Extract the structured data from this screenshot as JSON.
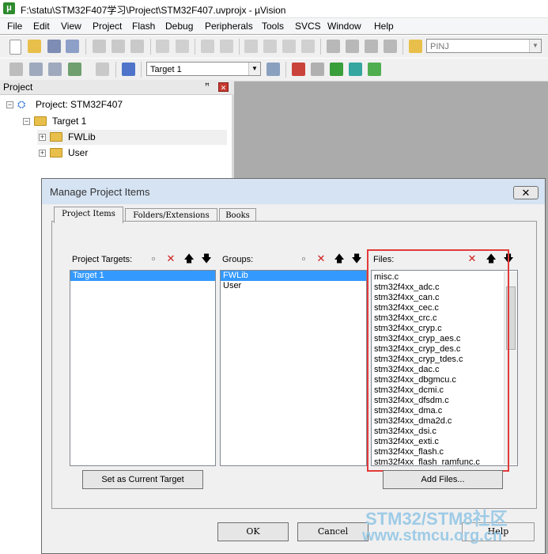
{
  "window": {
    "title": "F:\\statu\\STM32F407学习\\Project\\STM32F407.uvprojx - µVision",
    "icon": "uvision-app-icon"
  },
  "menu": [
    "File",
    "Edit",
    "View",
    "Project",
    "Flash",
    "Debug",
    "Peripherals",
    "Tools",
    "SVCS",
    "Window",
    "Help"
  ],
  "toolbar": {
    "find_combo": "PINJ",
    "target_combo": "Target 1"
  },
  "project_pane": {
    "title": "Project",
    "pin": "ꟸ",
    "close": "✕",
    "root": "Project: STM32F407",
    "target": "Target 1",
    "groups": [
      "FWLib",
      "User"
    ]
  },
  "dialog": {
    "title": "Manage Project Items",
    "close": "✕",
    "tabs": [
      "Project Items",
      "Folders/Extensions",
      "Books"
    ],
    "targets_header": "Project Targets:",
    "groups_header": "Groups:",
    "files_header": "Files:",
    "targets": [
      "Target 1"
    ],
    "groups": [
      "FWLib",
      "User"
    ],
    "files": [
      "misc.c",
      "stm32f4xx_adc.c",
      "stm32f4xx_can.c",
      "stm32f4xx_cec.c",
      "stm32f4xx_crc.c",
      "stm32f4xx_cryp.c",
      "stm32f4xx_cryp_aes.c",
      "stm32f4xx_cryp_des.c",
      "stm32f4xx_cryp_tdes.c",
      "stm32f4xx_dac.c",
      "stm32f4xx_dbgmcu.c",
      "stm32f4xx_dcmi.c",
      "stm32f4xx_dfsdm.c",
      "stm32f4xx_dma.c",
      "stm32f4xx_dma2d.c",
      "stm32f4xx_dsi.c",
      "stm32f4xx_exti.c",
      "stm32f4xx_flash.c",
      "stm32f4xx_flash_ramfunc.c"
    ],
    "set_target_button": "Set as Current Target",
    "add_files_button": "Add Files...",
    "ok_button": "OK",
    "cancel_button": "Cancel",
    "help_button": "Help",
    "icons": {
      "new": "new-item-icon",
      "delete": "✕",
      "up": "🡅",
      "down": "🡇"
    }
  },
  "watermark": {
    "line1": "STM32/STM8社区",
    "line2": "www.stmcu.org.cn"
  },
  "colors": {
    "highlight": "#e33a3a",
    "selection": "#3399ff",
    "watermark": "#9ecbe6"
  }
}
